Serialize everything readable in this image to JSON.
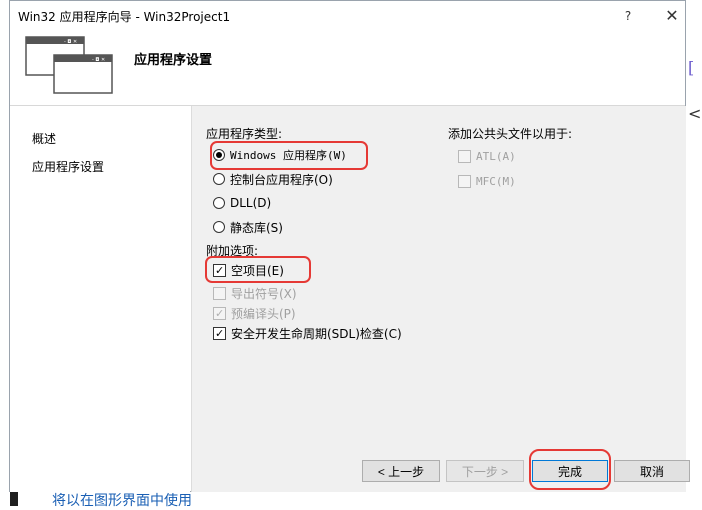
{
  "window": {
    "title": "Win32 应用程序向导 - Win32Project1",
    "help_label": "?",
    "close_label": "✕"
  },
  "header": {
    "title": "应用程序设置"
  },
  "nav": {
    "items": [
      {
        "label": "概述"
      },
      {
        "label": "应用程序设置"
      }
    ]
  },
  "app_type": {
    "label": "应用程序类型:",
    "options": [
      {
        "label": "Windows 应用程序(W)",
        "selected": true
      },
      {
        "label": "控制台应用程序(O)",
        "selected": false
      },
      {
        "label": "DLL(D)",
        "selected": false
      },
      {
        "label": "静态库(S)",
        "selected": false
      }
    ]
  },
  "additional": {
    "label": "附加选项:",
    "options": [
      {
        "label": "空项目(E)",
        "checked": true,
        "enabled": true
      },
      {
        "label": "导出符号(X)",
        "checked": false,
        "enabled": false
      },
      {
        "label": "预编译头(P)",
        "checked": true,
        "enabled": false
      },
      {
        "label": "安全开发生命周期(SDL)检查(C)",
        "checked": true,
        "enabled": true
      }
    ]
  },
  "common_headers": {
    "label": "添加公共头文件以用于:",
    "options": [
      {
        "label": "ATL(A)",
        "checked": false,
        "enabled": false
      },
      {
        "label": "MFC(M)",
        "checked": false,
        "enabled": false
      }
    ]
  },
  "buttons": {
    "prev": "< 上一步",
    "next": "下一步 >",
    "finish": "完成",
    "cancel": "取消"
  },
  "background": {
    "right_char_1": "[",
    "right_char_2": "<",
    "bottom_text": "将以在图形界面中使用"
  },
  "colors": {
    "highlight": "#e53935",
    "content_bg": "#f0f0f0",
    "accent": "#0078d7"
  }
}
